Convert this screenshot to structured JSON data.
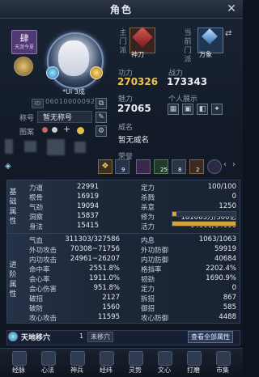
{
  "window": {
    "title": "角色",
    "close_icon": "close-icon"
  },
  "badge": {
    "glyph": "肆",
    "sub": "天涯今夏"
  },
  "profile": {
    "name": "*Ui 3成",
    "id_tag": "ID",
    "id_value": "06010000092",
    "title_label": "称号",
    "title_value": "暂无称号",
    "pattern_label": "图案",
    "fame_label": "威名",
    "fame_value": "暂无威名",
    "honor_label": "荣誉"
  },
  "school": {
    "main_label": "主门派",
    "main_name": "神刀",
    "current_label": "当前门派",
    "current_name": "万象"
  },
  "stats_top": {
    "gongli_label": "功力",
    "gongli_value": "270326",
    "zhanli_label": "战力",
    "zhanli_value": "173343",
    "meili_label": "魅力",
    "meili_value": "27065",
    "display_label": "个人展示"
  },
  "honor_counts": [
    "9",
    "25",
    "8",
    "2"
  ],
  "basic": {
    "side": "基础属性",
    "left": [
      {
        "label": "力道",
        "value": "22991"
      },
      {
        "label": "根骨",
        "value": "16919"
      },
      {
        "label": "气劲",
        "value": "19094"
      },
      {
        "label": "洞察",
        "value": "15837"
      },
      {
        "label": "身法",
        "value": "15415"
      }
    ],
    "right": [
      {
        "label": "定力",
        "value": "100/100"
      },
      {
        "label": "杀戮",
        "value": "0"
      },
      {
        "label": "杀意",
        "value": "1250"
      },
      {
        "label": "修为",
        "value": "181063万/300亿"
      },
      {
        "label": "活力",
        "value": "64000/64000"
      }
    ],
    "xiuwei_fill": 0.06,
    "huoli_fill": 1.0
  },
  "advanced": {
    "side": "进阶属性",
    "left": [
      {
        "label": "气血",
        "value": "311303/327586"
      },
      {
        "label": "外功攻击",
        "value": "70308~71756"
      },
      {
        "label": "内功攻击",
        "value": "24961~26207"
      },
      {
        "label": "命中率",
        "value": "2551.8%"
      },
      {
        "label": "会心率",
        "value": "1911.0%"
      },
      {
        "label": "会心伤害",
        "value": "951.8%"
      },
      {
        "label": "破招",
        "value": "2127"
      },
      {
        "label": "破防",
        "value": "1560"
      },
      {
        "label": "攻心攻击",
        "value": "11595"
      }
    ],
    "right": [
      {
        "label": "内息",
        "value": "1063/1063"
      },
      {
        "label": "外功防御",
        "value": "59919"
      },
      {
        "label": "内功防御",
        "value": "40684"
      },
      {
        "label": "格挡率",
        "value": "2202.4%"
      },
      {
        "label": "韧劲",
        "value": "1690.9%"
      },
      {
        "label": "定力",
        "value": "0"
      },
      {
        "label": "拆招",
        "value": "867"
      },
      {
        "label": "御招",
        "value": "585"
      },
      {
        "label": "攻心防御",
        "value": "4488"
      }
    ]
  },
  "acupoint": {
    "name": "天地移穴",
    "count": "1",
    "status": "未移穴",
    "view_all": "查看全部属性"
  },
  "nav": [
    {
      "label": "经脉",
      "icon": "meridian-icon"
    },
    {
      "label": "心法",
      "icon": "heart-skill-icon"
    },
    {
      "label": "神兵",
      "icon": "weapon-icon"
    },
    {
      "label": "经纬",
      "icon": "latitude-icon"
    },
    {
      "label": "灵势",
      "icon": "spirit-icon"
    },
    {
      "label": "文心",
      "icon": "wenxin-icon"
    },
    {
      "label": "打磨",
      "icon": "polish-icon"
    },
    {
      "label": "市集",
      "icon": "market-icon"
    }
  ]
}
